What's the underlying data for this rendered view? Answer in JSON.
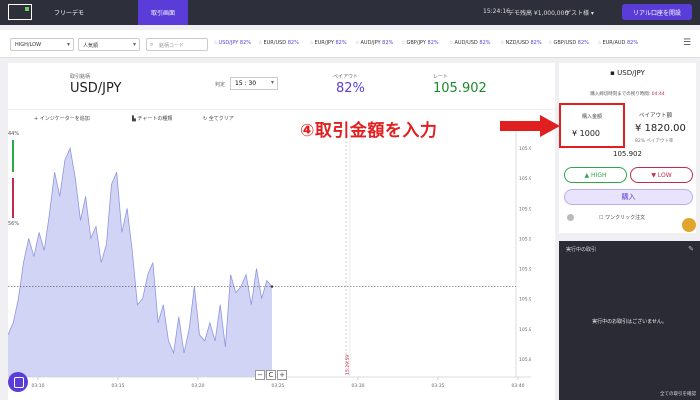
{
  "topbar": {
    "free_demo": "フリーデモ",
    "active_tab": "取引画面",
    "time": "15:24:16",
    "balance": "デモ残高  ¥1,000,000",
    "user": "ゲスト様  ▾",
    "real_account_button": "リアル口座を開設"
  },
  "filterbar": {
    "type_select": "HIGH/LOW",
    "sort_select": "人気順",
    "search_placeholder": "銘柄コード",
    "pairs": [
      {
        "name": "USD/JPY",
        "pct": "82%"
      },
      {
        "name": "EUR/USD",
        "pct": "82%"
      },
      {
        "name": "EUR/JPY",
        "pct": "82%"
      },
      {
        "name": "AUD/JPY",
        "pct": "82%"
      },
      {
        "name": "GBP/JPY",
        "pct": "82%"
      },
      {
        "name": "AUD/USD",
        "pct": "82%"
      },
      {
        "name": "NZD/USD",
        "pct": "82%"
      },
      {
        "name": "GBP/USD",
        "pct": "82%"
      },
      {
        "name": "EUR/AUD",
        "pct": "82%"
      }
    ]
  },
  "main": {
    "asset_label": "取引銘柄",
    "asset_name": "USD/JPY",
    "expiry_label": "判定",
    "expiry_value": "15 : 30",
    "payout_label": "ペイアウト",
    "payout_value": "82%",
    "rate_label": "レート",
    "rate_value": "105.902",
    "tools": {
      "indicator": "インジケーターを追加",
      "chart_type": "チャートの種類",
      "clear": "全てクリア"
    },
    "chart_pct_top": "44%",
    "chart_pct_mid": "56%",
    "zoom_minus": "−",
    "zoom_reset": "C",
    "zoom_plus": "+"
  },
  "chart_data": {
    "type": "area",
    "x_ticks": [
      "03:10",
      "03:15",
      "03:20",
      "03:25",
      "03:30",
      "03:35",
      "03:40"
    ],
    "y_ticks": [
      "105.925",
      "105.920",
      "105.915",
      "105.910",
      "105.905",
      "105.900",
      "105.895",
      "105.890"
    ],
    "ylim": [
      105.887,
      105.928
    ],
    "reference_line": 105.902,
    "expiry_marker": "15:29:59",
    "values": [
      105.894,
      105.896,
      105.9,
      105.906,
      105.91,
      105.907,
      105.911,
      105.908,
      105.914,
      105.921,
      105.917,
      105.923,
      105.925,
      105.92,
      105.913,
      105.917,
      105.91,
      105.912,
      105.906,
      105.909,
      105.919,
      105.921,
      105.911,
      105.915,
      105.908,
      105.899,
      105.9,
      105.904,
      105.906,
      105.896,
      105.899,
      105.893,
      105.891,
      105.897,
      105.891,
      105.895,
      105.902,
      105.894,
      105.893,
      105.896,
      105.893,
      105.899,
      105.892,
      105.904,
      105.901,
      105.902,
      105.904,
      105.899,
      105.905,
      105.9,
      105.903,
      105.902
    ]
  },
  "panel": {
    "asset": "USD/JPY",
    "remain_label": "購入締切時刻までの残り時間:",
    "remain_time": "04:44",
    "amount_label": "購入金額",
    "amount_value": "¥ 1000",
    "payout_label": "ペイアウト額",
    "payout_amount": "¥ 1820.00",
    "payout_rate": "82% ペイアウト率",
    "rate": "105.902",
    "high": "HIGH",
    "low": "LOW",
    "buy": "購入",
    "oneclick": "ワンクリック注文"
  },
  "trades": {
    "title": "実行中の取引",
    "empty": "実行中のお取引はございません。",
    "view_all": "全ての取引を確認"
  },
  "annotation": "④取引金額を入力",
  "colors": {
    "accent": "#5a3dd9",
    "high": "#2aa84a",
    "low": "#c42a4b",
    "highlight": "#e02020"
  }
}
